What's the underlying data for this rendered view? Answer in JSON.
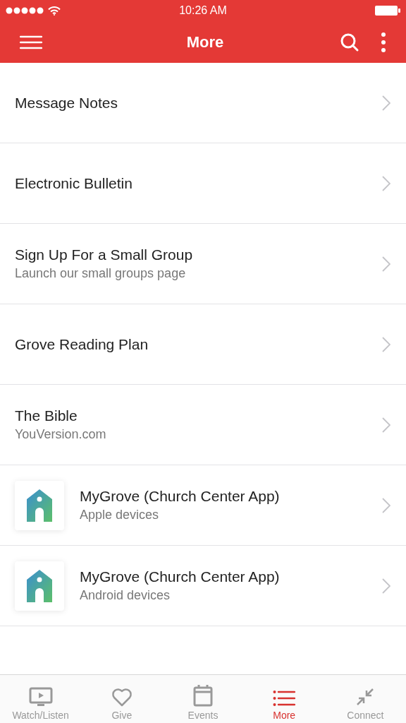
{
  "status_bar": {
    "time": "10:26 AM"
  },
  "nav_bar": {
    "title": "More"
  },
  "items": [
    {
      "kind": "plain",
      "title": "Message Notes"
    },
    {
      "kind": "plain",
      "title": "Electronic Bulletin"
    },
    {
      "kind": "plain",
      "title": "Sign Up For a Small Group",
      "subtitle": "Launch our small groups page"
    },
    {
      "kind": "plain",
      "title": "Grove Reading Plan"
    },
    {
      "kind": "plain",
      "title": "The Bible",
      "subtitle": "YouVersion.com"
    },
    {
      "kind": "app",
      "title": "MyGrove (Church Center App)",
      "subtitle": "Apple devices"
    },
    {
      "kind": "app",
      "title": "MyGrove (Church Center App)",
      "subtitle": "Android devices"
    }
  ],
  "tabs": [
    {
      "label": "Watch/Listen",
      "selected": false
    },
    {
      "label": "Give",
      "selected": false
    },
    {
      "label": "Events",
      "selected": false
    },
    {
      "label": "More",
      "selected": true
    },
    {
      "label": "Connect",
      "selected": false
    }
  ]
}
